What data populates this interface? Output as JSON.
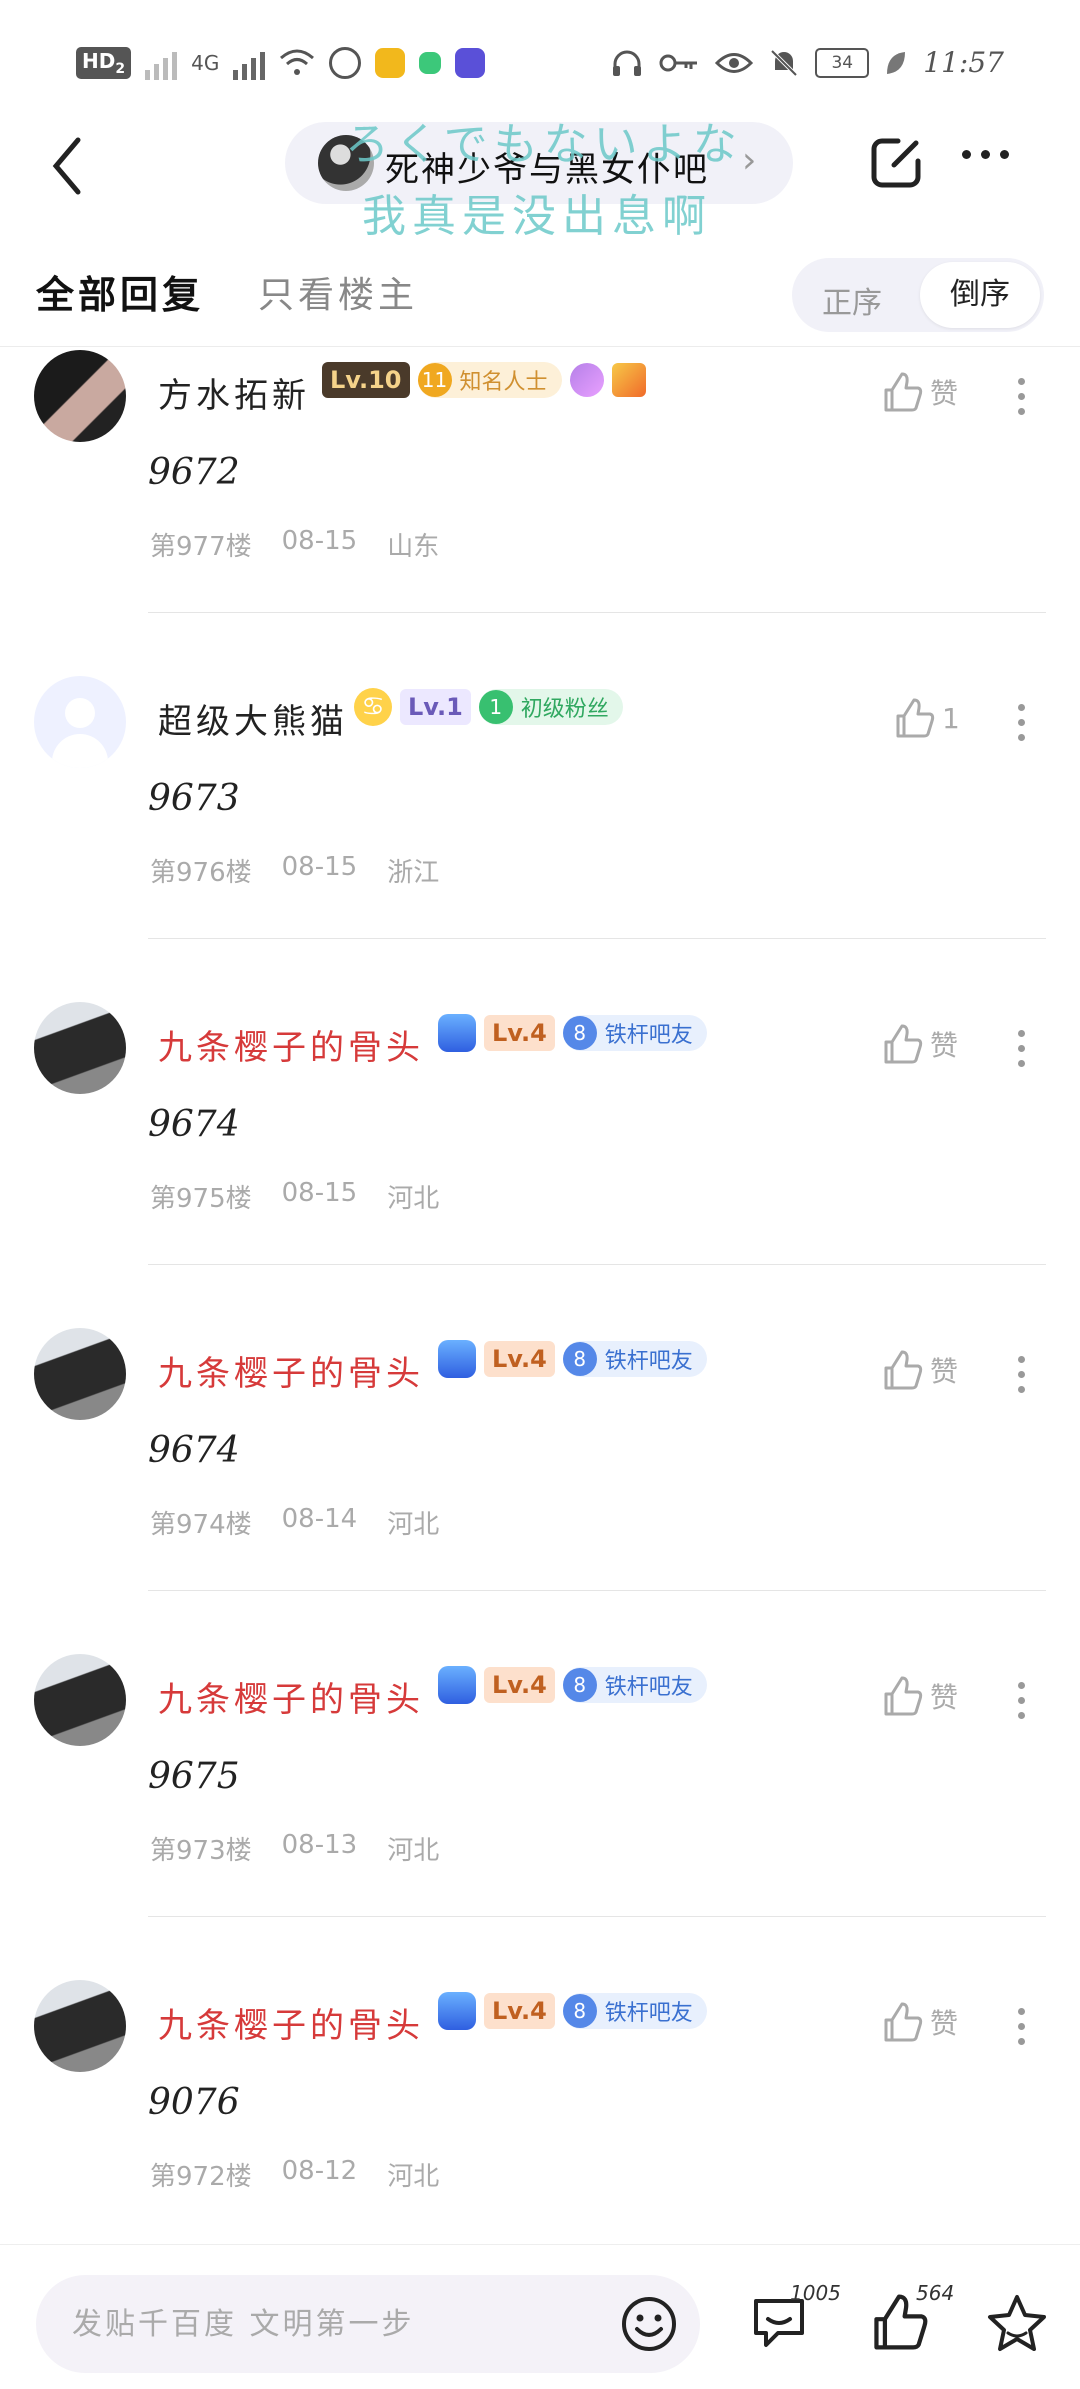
{
  "status_bar": {
    "hd_badge": "HD",
    "hd_sub": "2",
    "network_label": "4G",
    "battery": "34",
    "time": "11:57"
  },
  "nav": {
    "forum_name": "死神少爷与黑女仆吧",
    "overlay_jp": "ろくでもないよな",
    "overlay_cn": "我真是没出息啊"
  },
  "tabs": {
    "all": "全部回复",
    "op_only": "只看楼主",
    "sort_asc": "正序",
    "sort_desc": "倒序"
  },
  "posts": [
    {
      "username": "方水拓新",
      "level": "Lv.10",
      "fan_level": "11",
      "fan_title": "知名人士",
      "content": "9672",
      "floor": "第977楼",
      "date": "08-15",
      "location": "山东",
      "like_label": "赞"
    },
    {
      "username": "超级大熊猫",
      "level": "Lv.1",
      "fan_level": "1",
      "fan_title": "初级粉丝",
      "content": "9673",
      "floor": "第976楼",
      "date": "08-15",
      "location": "浙江",
      "like_label": "1"
    },
    {
      "username": "九条樱子的骨头",
      "level": "Lv.4",
      "fan_level": "8",
      "fan_title": "铁杆吧友",
      "content": "9674",
      "floor": "第975楼",
      "date": "08-15",
      "location": "河北",
      "like_label": "赞"
    },
    {
      "username": "九条樱子的骨头",
      "level": "Lv.4",
      "fan_level": "8",
      "fan_title": "铁杆吧友",
      "content": "9674",
      "floor": "第974楼",
      "date": "08-14",
      "location": "河北",
      "like_label": "赞"
    },
    {
      "username": "九条樱子的骨头",
      "level": "Lv.4",
      "fan_level": "8",
      "fan_title": "铁杆吧友",
      "content": "9675",
      "floor": "第973楼",
      "date": "08-13",
      "location": "河北",
      "like_label": "赞"
    },
    {
      "username": "九条樱子的骨头",
      "level": "Lv.4",
      "fan_level": "8",
      "fan_title": "铁杆吧友",
      "content": "9076",
      "floor": "第972楼",
      "date": "08-12",
      "location": "河北",
      "like_label": "赞"
    }
  ],
  "bottom_bar": {
    "placeholder": "发贴千百度 文明第一步",
    "comment_count": "1005",
    "like_count": "564"
  },
  "icons": [
    "back-icon",
    "edit-icon",
    "more-icon",
    "thumb-up-icon",
    "kebab-icon",
    "emoji-icon",
    "comment-icon",
    "star-icon",
    "headphones-icon",
    "key-icon",
    "eye-icon",
    "mute-bell-icon",
    "wifi-icon",
    "leaf-icon"
  ],
  "colors": {
    "red_username": "#d63a3a",
    "pill_bg": "#f1f1f8",
    "overlay_text": "#6cc9c9"
  }
}
